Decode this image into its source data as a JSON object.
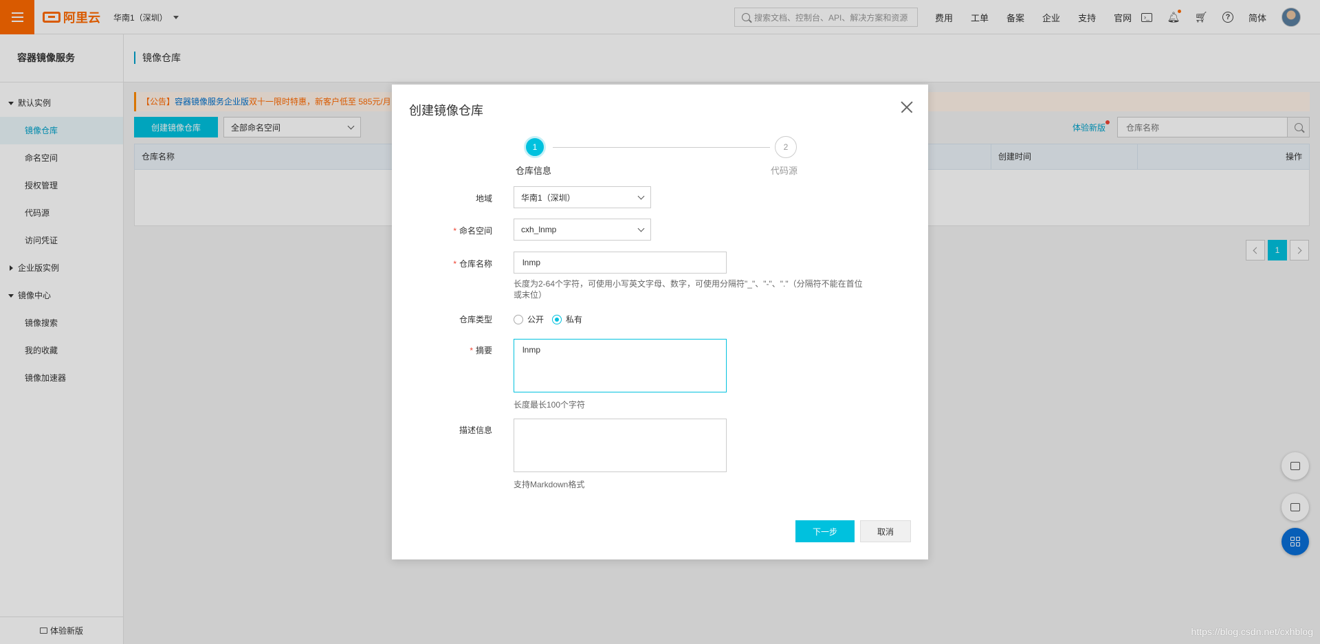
{
  "topbar": {
    "logo_text": "阿里云",
    "region": "华南1（深圳）",
    "search_placeholder": "搜索文档、控制台、API、解决方案和资源",
    "nav": [
      "费用",
      "工单",
      "备案",
      "企业",
      "支持",
      "官网"
    ],
    "lang": "简体",
    "icons": [
      "terminal-icon",
      "bell-icon",
      "cart-icon",
      "help-icon"
    ],
    "accent_color": "#ff6a00"
  },
  "sidebar": {
    "title": "容器镜像服务",
    "group_default": "默认实例",
    "items_default": [
      "镜像仓库",
      "命名空间",
      "授权管理",
      "代码源",
      "访问凭证"
    ],
    "group_enterprise": "企业版实例",
    "group_center": "镜像中心",
    "items_center": [
      "镜像搜索",
      "我的收藏",
      "镜像加速器"
    ],
    "footer": "体验新版"
  },
  "main": {
    "title": "镜像仓库",
    "notice_prefix": "【公告】",
    "notice_link": "容器镜像服务企业版",
    "notice_mid": "双十一限时特惠",
    "notice_tail": "，新客户低至 585元/月",
    "create_button": "创建镜像仓库",
    "namespace_filter": "全部命名空间",
    "try_new": "体验新版",
    "search_placeholder": "仓库名称",
    "columns": {
      "name": "仓库名称",
      "created": "创建时间",
      "actions": "操作"
    },
    "page": "1"
  },
  "modal": {
    "title": "创建镜像仓库",
    "steps": [
      {
        "num": "1",
        "label": "仓库信息"
      },
      {
        "num": "2",
        "label": "代码源"
      }
    ],
    "region_label": "地域",
    "region_value": "华南1（深圳）",
    "namespace_label": "命名空间",
    "namespace_value": "cxh_lnmp",
    "repo_name_label": "仓库名称",
    "repo_name_value": "lnmp",
    "repo_name_help": "长度为2-64个字符，可使用小写英文字母、数字，可使用分隔符\"_\"、\"-\"、\".\"（分隔符不能在首位或末位）",
    "repo_type_label": "仓库类型",
    "type_public": "公开",
    "type_private": "私有",
    "summary_label": "摘要",
    "summary_value": "lnmp",
    "summary_help": "长度最长100个字符",
    "desc_label": "描述信息",
    "desc_value": "",
    "desc_help": "支持Markdown格式",
    "next_button": "下一步",
    "cancel_button": "取消"
  },
  "watermark": "https://blog.csdn.net/cxhblog",
  "colors": {
    "primary": "#00c1de",
    "link": "#00a2ca",
    "required": "#ee4433"
  }
}
